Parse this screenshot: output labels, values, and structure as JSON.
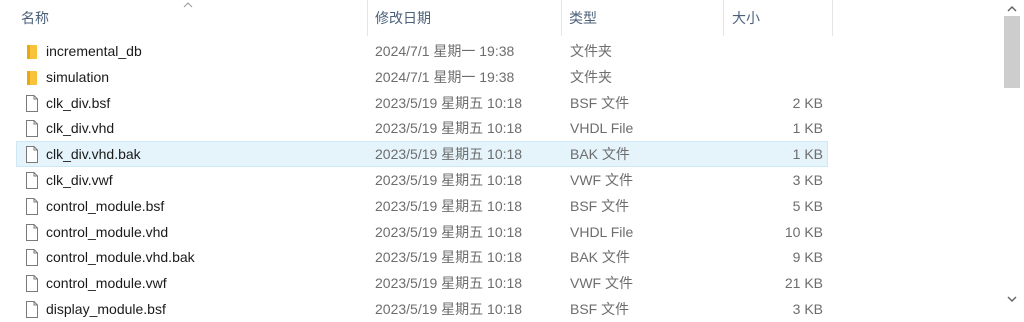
{
  "header": {
    "name": "名称",
    "date": "修改日期",
    "type": "类型",
    "size": "大小"
  },
  "files": [
    {
      "name": "incremental_db",
      "date": "2024/7/1 星期一 19:38",
      "type": "文件夹",
      "size": "",
      "icon": "folder-icon",
      "selected": false
    },
    {
      "name": "simulation",
      "date": "2024/7/1 星期一 19:38",
      "type": "文件夹",
      "size": "",
      "icon": "folder-icon",
      "selected": false
    },
    {
      "name": "clk_div.bsf",
      "date": "2023/5/19 星期五 10:18",
      "type": "BSF 文件",
      "size": "2 KB",
      "icon": "file-icon",
      "selected": false
    },
    {
      "name": "clk_div.vhd",
      "date": "2023/5/19 星期五 10:18",
      "type": "VHDL File",
      "size": "1 KB",
      "icon": "file-icon",
      "selected": false
    },
    {
      "name": "clk_div.vhd.bak",
      "date": "2023/5/19 星期五 10:18",
      "type": "BAK 文件",
      "size": "1 KB",
      "icon": "file-icon",
      "selected": true
    },
    {
      "name": "clk_div.vwf",
      "date": "2023/5/19 星期五 10:18",
      "type": "VWF 文件",
      "size": "3 KB",
      "icon": "file-icon",
      "selected": false
    },
    {
      "name": "control_module.bsf",
      "date": "2023/5/19 星期五 10:18",
      "type": "BSF 文件",
      "size": "5 KB",
      "icon": "file-icon",
      "selected": false
    },
    {
      "name": "control_module.vhd",
      "date": "2023/5/19 星期五 10:18",
      "type": "VHDL File",
      "size": "10 KB",
      "icon": "file-icon",
      "selected": false
    },
    {
      "name": "control_module.vhd.bak",
      "date": "2023/5/19 星期五 10:18",
      "type": "BAK 文件",
      "size": "9 KB",
      "icon": "file-icon",
      "selected": false
    },
    {
      "name": "control_module.vwf",
      "date": "2023/5/19 星期五 10:18",
      "type": "VWF 文件",
      "size": "21 KB",
      "icon": "file-icon",
      "selected": false
    },
    {
      "name": "display_module.bsf",
      "date": "2023/5/19 星期五 10:18",
      "type": "BSF 文件",
      "size": "3 KB",
      "icon": "file-icon",
      "selected": false
    }
  ],
  "colors": {
    "folder": "#f8c338",
    "folder_dark": "#e6a817",
    "selected_bg": "#e5f3fb",
    "header_text": "#4c607a",
    "scroll_thumb": "#cdcdcd"
  }
}
